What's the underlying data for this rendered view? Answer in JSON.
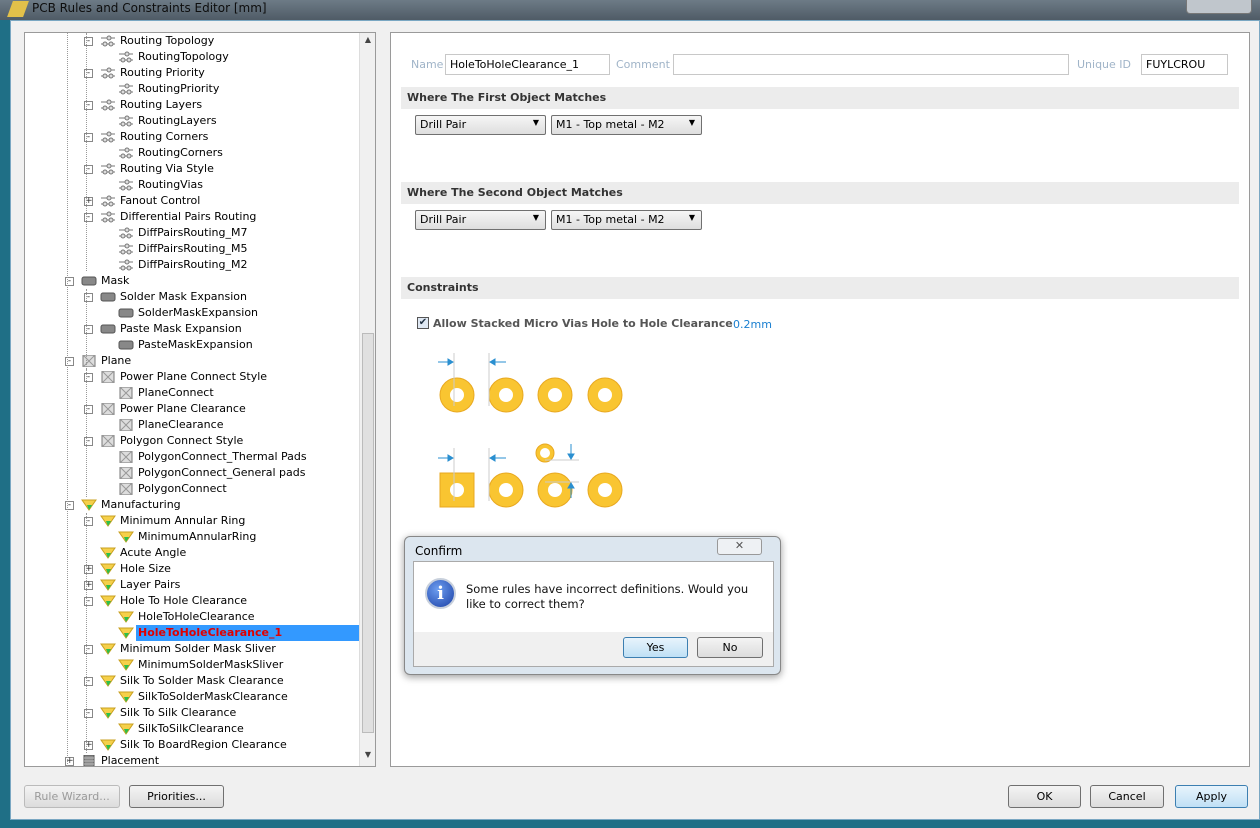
{
  "window": {
    "title": "PCB Rules and Constraints Editor [mm]"
  },
  "tree": [
    {
      "label": "Routing Topology",
      "level": 2,
      "icon": "routing",
      "pm": "-"
    },
    {
      "label": "RoutingTopology",
      "level": 3,
      "icon": "routing"
    },
    {
      "label": "Routing Priority",
      "level": 2,
      "icon": "routing",
      "pm": "-"
    },
    {
      "label": "RoutingPriority",
      "level": 3,
      "icon": "routing"
    },
    {
      "label": "Routing Layers",
      "level": 2,
      "icon": "routing",
      "pm": "-"
    },
    {
      "label": "RoutingLayers",
      "level": 3,
      "icon": "routing"
    },
    {
      "label": "Routing Corners",
      "level": 2,
      "icon": "routing",
      "pm": "-"
    },
    {
      "label": "RoutingCorners",
      "level": 3,
      "icon": "routing"
    },
    {
      "label": "Routing Via Style",
      "level": 2,
      "icon": "routing",
      "pm": "-"
    },
    {
      "label": "RoutingVias",
      "level": 3,
      "icon": "routing"
    },
    {
      "label": "Fanout Control",
      "level": 2,
      "icon": "routing",
      "pm": "+"
    },
    {
      "label": "Differential Pairs Routing",
      "level": 2,
      "icon": "routing",
      "pm": "-"
    },
    {
      "label": "DiffPairsRouting_M7",
      "level": 3,
      "icon": "routing"
    },
    {
      "label": "DiffPairsRouting_M5",
      "level": 3,
      "icon": "routing"
    },
    {
      "label": "DiffPairsRouting_M2",
      "level": 3,
      "icon": "routing"
    },
    {
      "label": "Mask",
      "level": 1,
      "icon": "mask",
      "pm": "-"
    },
    {
      "label": "Solder Mask Expansion",
      "level": 2,
      "icon": "mask",
      "pm": "-"
    },
    {
      "label": "SolderMaskExpansion",
      "level": 3,
      "icon": "mask"
    },
    {
      "label": "Paste Mask Expansion",
      "level": 2,
      "icon": "mask",
      "pm": "-"
    },
    {
      "label": "PasteMaskExpansion",
      "level": 3,
      "icon": "mask"
    },
    {
      "label": "Plane",
      "level": 1,
      "icon": "plane",
      "pm": "-"
    },
    {
      "label": "Power Plane Connect Style",
      "level": 2,
      "icon": "plane",
      "pm": "-"
    },
    {
      "label": "PlaneConnect",
      "level": 3,
      "icon": "plane"
    },
    {
      "label": "Power Plane Clearance",
      "level": 2,
      "icon": "plane",
      "pm": "-"
    },
    {
      "label": "PlaneClearance",
      "level": 3,
      "icon": "plane"
    },
    {
      "label": "Polygon Connect Style",
      "level": 2,
      "icon": "plane",
      "pm": "-"
    },
    {
      "label": "PolygonConnect_Thermal Pads",
      "level": 3,
      "icon": "plane"
    },
    {
      "label": "PolygonConnect_General pads",
      "level": 3,
      "icon": "plane"
    },
    {
      "label": "PolygonConnect",
      "level": 3,
      "icon": "plane"
    },
    {
      "label": "Manufacturing",
      "level": 1,
      "icon": "manufacturing",
      "pm": "-"
    },
    {
      "label": "Minimum Annular Ring",
      "level": 2,
      "icon": "manufacturing",
      "pm": "-"
    },
    {
      "label": "MinimumAnnularRing",
      "level": 3,
      "icon": "manufacturing"
    },
    {
      "label": "Acute Angle",
      "level": 2,
      "icon": "manufacturing"
    },
    {
      "label": "Hole Size",
      "level": 2,
      "icon": "manufacturing",
      "pm": "+"
    },
    {
      "label": "Layer Pairs",
      "level": 2,
      "icon": "manufacturing",
      "pm": "+"
    },
    {
      "label": "Hole To Hole Clearance",
      "level": 2,
      "icon": "manufacturing",
      "pm": "-"
    },
    {
      "label": "HoleToHoleClearance",
      "level": 3,
      "icon": "manufacturing"
    },
    {
      "label": "HoleToHoleClearance_1",
      "level": 3,
      "icon": "manufacturing",
      "selected": true
    },
    {
      "label": "Minimum Solder Mask Sliver",
      "level": 2,
      "icon": "manufacturing",
      "pm": "-"
    },
    {
      "label": "MinimumSolderMaskSliver",
      "level": 3,
      "icon": "manufacturing"
    },
    {
      "label": "Silk To Solder Mask Clearance",
      "level": 2,
      "icon": "manufacturing",
      "pm": "-"
    },
    {
      "label": "SilkToSolderMaskClearance",
      "level": 3,
      "icon": "manufacturing"
    },
    {
      "label": "Silk To Silk Clearance",
      "level": 2,
      "icon": "manufacturing",
      "pm": "-"
    },
    {
      "label": "SilkToSilkClearance",
      "level": 3,
      "icon": "manufacturing"
    },
    {
      "label": "Silk To BoardRegion Clearance",
      "level": 2,
      "icon": "manufacturing",
      "pm": "+"
    },
    {
      "label": "Placement",
      "level": 1,
      "icon": "placement",
      "pm": "+"
    }
  ],
  "rule": {
    "name_label": "Name",
    "name": "HoleToHoleClearance_1",
    "comment_label": "Comment",
    "comment": "",
    "uid_label": "Unique ID",
    "uid": "FUYLCROU",
    "first_title": "Where The First Object Matches",
    "first_type": "Drill Pair",
    "first_value": "M1 - Top metal - M2",
    "second_title": "Where The Second Object Matches",
    "second_type": "Drill Pair",
    "second_value": "M1 - Top metal - M2",
    "constraints_title": "Constraints",
    "allow_stacked_label": "Allow Stacked Micro Vias",
    "allow_stacked": true,
    "clearance_label": "Hole to Hole Clearance",
    "clearance_value": "0.2mm"
  },
  "dialog": {
    "title": "Confirm",
    "message": "Some rules have incorrect definitions. Would you like to correct them?",
    "yes": "Yes",
    "no": "No",
    "close": "✕"
  },
  "buttons": {
    "rule_wizard": "Rule Wizard...",
    "priorities": "Priorities...",
    "ok": "OK",
    "cancel": "Cancel",
    "apply": "Apply"
  },
  "colors": {
    "pad": "#f9c531",
    "accent": "#2a8fd0",
    "selection": "#3399ff"
  }
}
